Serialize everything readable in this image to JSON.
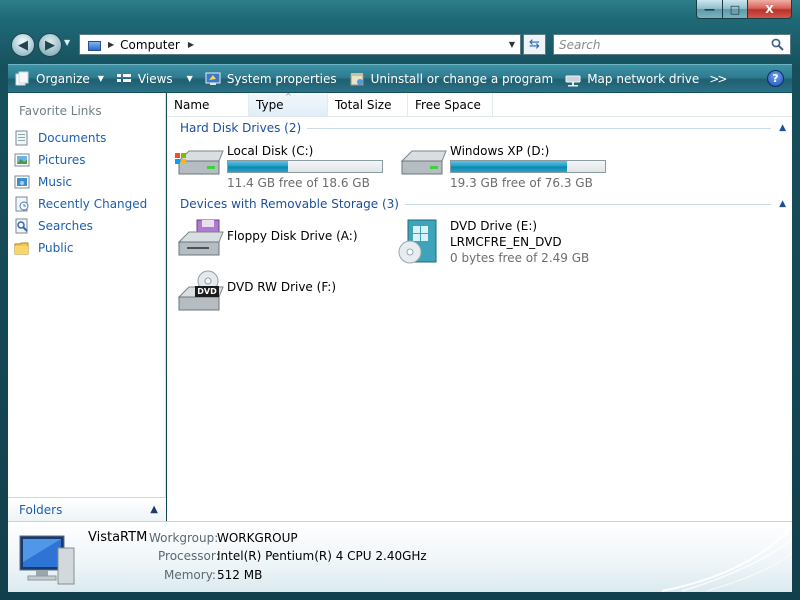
{
  "window": {
    "minimize_glyph": "—",
    "maximize_glyph": "□",
    "close_glyph": "X"
  },
  "address_bar": {
    "path": "Computer",
    "search_placeholder": "Search"
  },
  "command_bar": {
    "organize": "Organize",
    "views": "Views",
    "system_properties": "System properties",
    "uninstall": "Uninstall or change a program",
    "map_drive": "Map network drive",
    "more": ">>",
    "help": "?"
  },
  "nav_pane": {
    "title": "Favorite Links",
    "items": [
      {
        "label": "Documents",
        "icon": "documents-icon"
      },
      {
        "label": "Pictures",
        "icon": "pictures-icon"
      },
      {
        "label": "Music",
        "icon": "music-icon"
      },
      {
        "label": "Recently Changed",
        "icon": "recently-changed-icon"
      },
      {
        "label": "Searches",
        "icon": "searches-icon"
      },
      {
        "label": "Public",
        "icon": "public-folder-icon"
      }
    ],
    "folders_label": "Folders"
  },
  "columns": [
    {
      "label": "Name"
    },
    {
      "label": "Type"
    },
    {
      "label": "Total Size"
    },
    {
      "label": "Free Space"
    }
  ],
  "groups": [
    {
      "title": "Hard Disk Drives (2)",
      "items": [
        {
          "name": "Local Disk (C:)",
          "free": "11.4 GB free of 18.6 GB",
          "used_fraction": 0.39
        },
        {
          "name": "Windows XP (D:)",
          "free": "19.3 GB free of 76.3 GB",
          "used_fraction": 0.75
        }
      ]
    },
    {
      "title": "Devices with Removable Storage (3)",
      "items": [
        {
          "name": "Floppy Disk Drive (A:)"
        },
        {
          "name": "DVD Drive (E:)",
          "label": "LRMCFRE_EN_DVD",
          "free": "0 bytes free of 2.49 GB"
        },
        {
          "name": "DVD RW Drive (F:)",
          "badge": "DVD"
        }
      ]
    }
  ],
  "details": {
    "computer_name": "VistaRTM",
    "workgroup_label": "Workgroup:",
    "workgroup": "WORKGROUP",
    "processor_label": "Processor:",
    "processor": "Intel(R) Pentium(R) 4 CPU 2.40GHz",
    "memory_label": "Memory:",
    "memory": "512 MB"
  },
  "colors": {
    "accent_link": "#1c5fb0",
    "group_heading": "#1b4f9c",
    "capacity_fill": "#1fa0c6",
    "frame": "#1f6a78"
  }
}
